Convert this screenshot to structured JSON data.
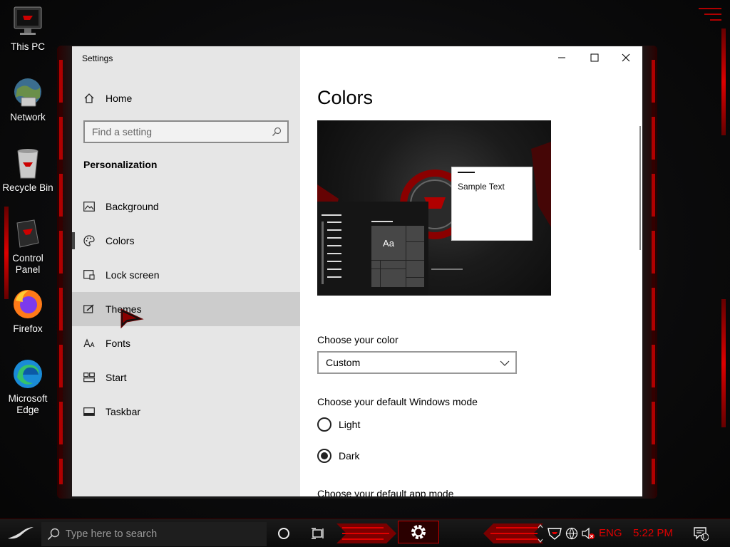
{
  "desktop": {
    "icons": [
      {
        "label": "This PC",
        "icon": "this-pc-icon"
      },
      {
        "label": "Network",
        "icon": "network-icon"
      },
      {
        "label": "Recycle Bin",
        "icon": "recycle-bin-icon"
      },
      {
        "label": "Control Panel",
        "icon": "control-panel-icon"
      },
      {
        "label": "Firefox",
        "icon": "firefox-icon"
      },
      {
        "label": "Microsoft Edge",
        "icon": "edge-icon"
      }
    ]
  },
  "window": {
    "title": "Settings",
    "caption": {
      "minimize": "minimize-icon",
      "maximize": "maximize-icon",
      "close": "close-icon"
    }
  },
  "nav": {
    "home_label": "Home",
    "search_placeholder": "Find a setting",
    "section": "Personalization",
    "items": [
      {
        "label": "Background",
        "icon": "picture-icon"
      },
      {
        "label": "Colors",
        "icon": "palette-icon",
        "selected": true
      },
      {
        "label": "Lock screen",
        "icon": "lock-screen-icon"
      },
      {
        "label": "Themes",
        "icon": "brush-icon",
        "hovered": true
      },
      {
        "label": "Fonts",
        "icon": "font-icon"
      },
      {
        "label": "Start",
        "icon": "start-icon"
      },
      {
        "label": "Taskbar",
        "icon": "taskbar-icon"
      }
    ]
  },
  "content": {
    "title": "Colors",
    "preview": {
      "sample_text": "Sample Text",
      "tile_text": "Aa"
    },
    "choose_color_label": "Choose your color",
    "choose_color_value": "Custom",
    "windows_mode_label": "Choose your default Windows mode",
    "windows_mode_options": [
      {
        "label": "Light",
        "checked": false
      },
      {
        "label": "Dark",
        "checked": true
      }
    ],
    "app_mode_label": "Choose your default app mode"
  },
  "taskbar": {
    "search_placeholder": "Type here to search",
    "language": "ENG",
    "time": "5:22 PM",
    "notification_count": "1",
    "accent_color": "#e00000"
  }
}
